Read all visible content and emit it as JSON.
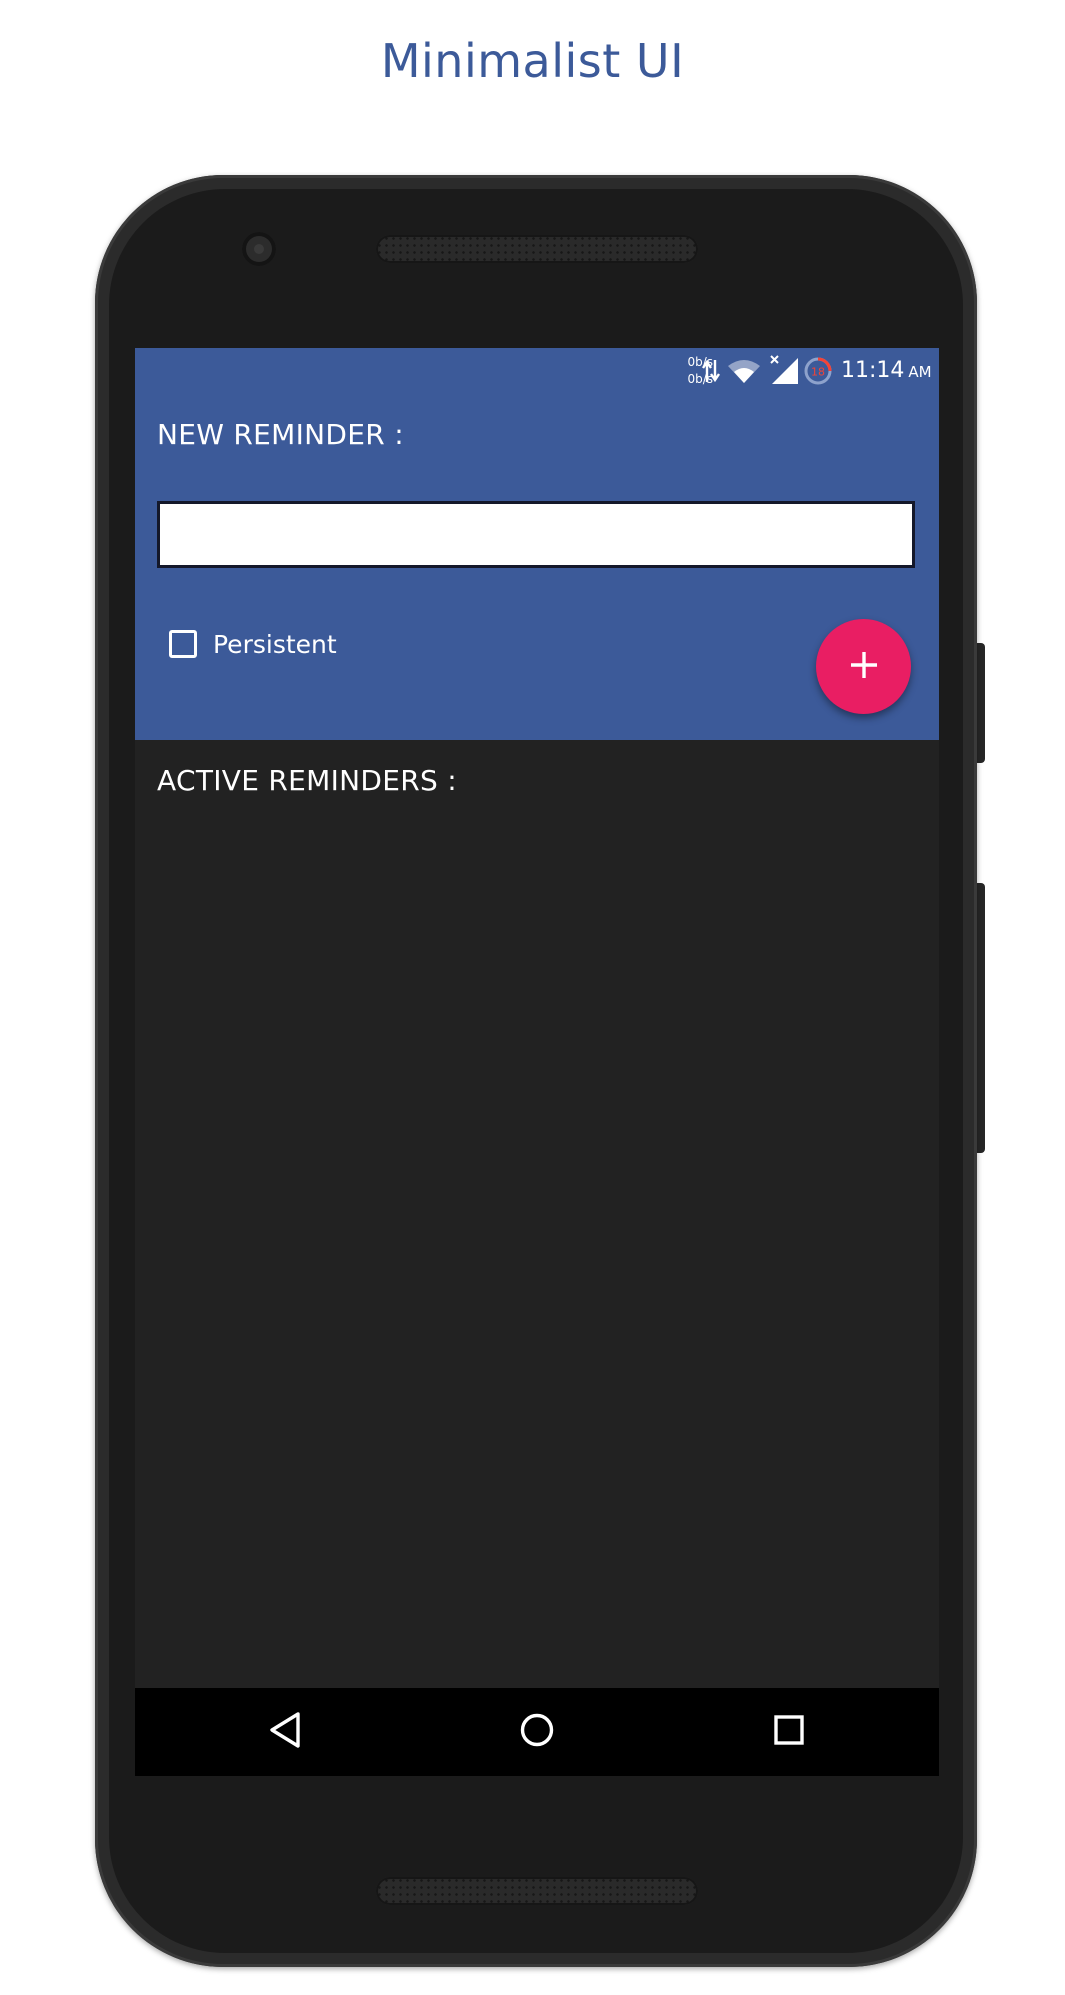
{
  "promo": {
    "title": "Minimalist UI"
  },
  "status_bar": {
    "net_up": "0b/s",
    "net_down": "0b/s",
    "icons": [
      "data-transfer-icon",
      "wifi-icon",
      "signal-icon",
      "battery-saver-icon"
    ],
    "battery_badge": "18",
    "time": "11:14",
    "ampm": "AM"
  },
  "new_reminder": {
    "label": "NEW REMINDER :",
    "input_value": "",
    "persistent_label": "Persistent",
    "persistent_checked": false,
    "add_icon": "plus-icon"
  },
  "active_reminders": {
    "label": "ACTIVE REMINDERS :",
    "items": []
  },
  "nav_bar": {
    "icons": [
      "back-icon",
      "home-icon",
      "recents-icon"
    ]
  },
  "colors": {
    "primary": "#3c5a99",
    "accent": "#e91e63",
    "background": "#222222",
    "nav": "#000000"
  }
}
